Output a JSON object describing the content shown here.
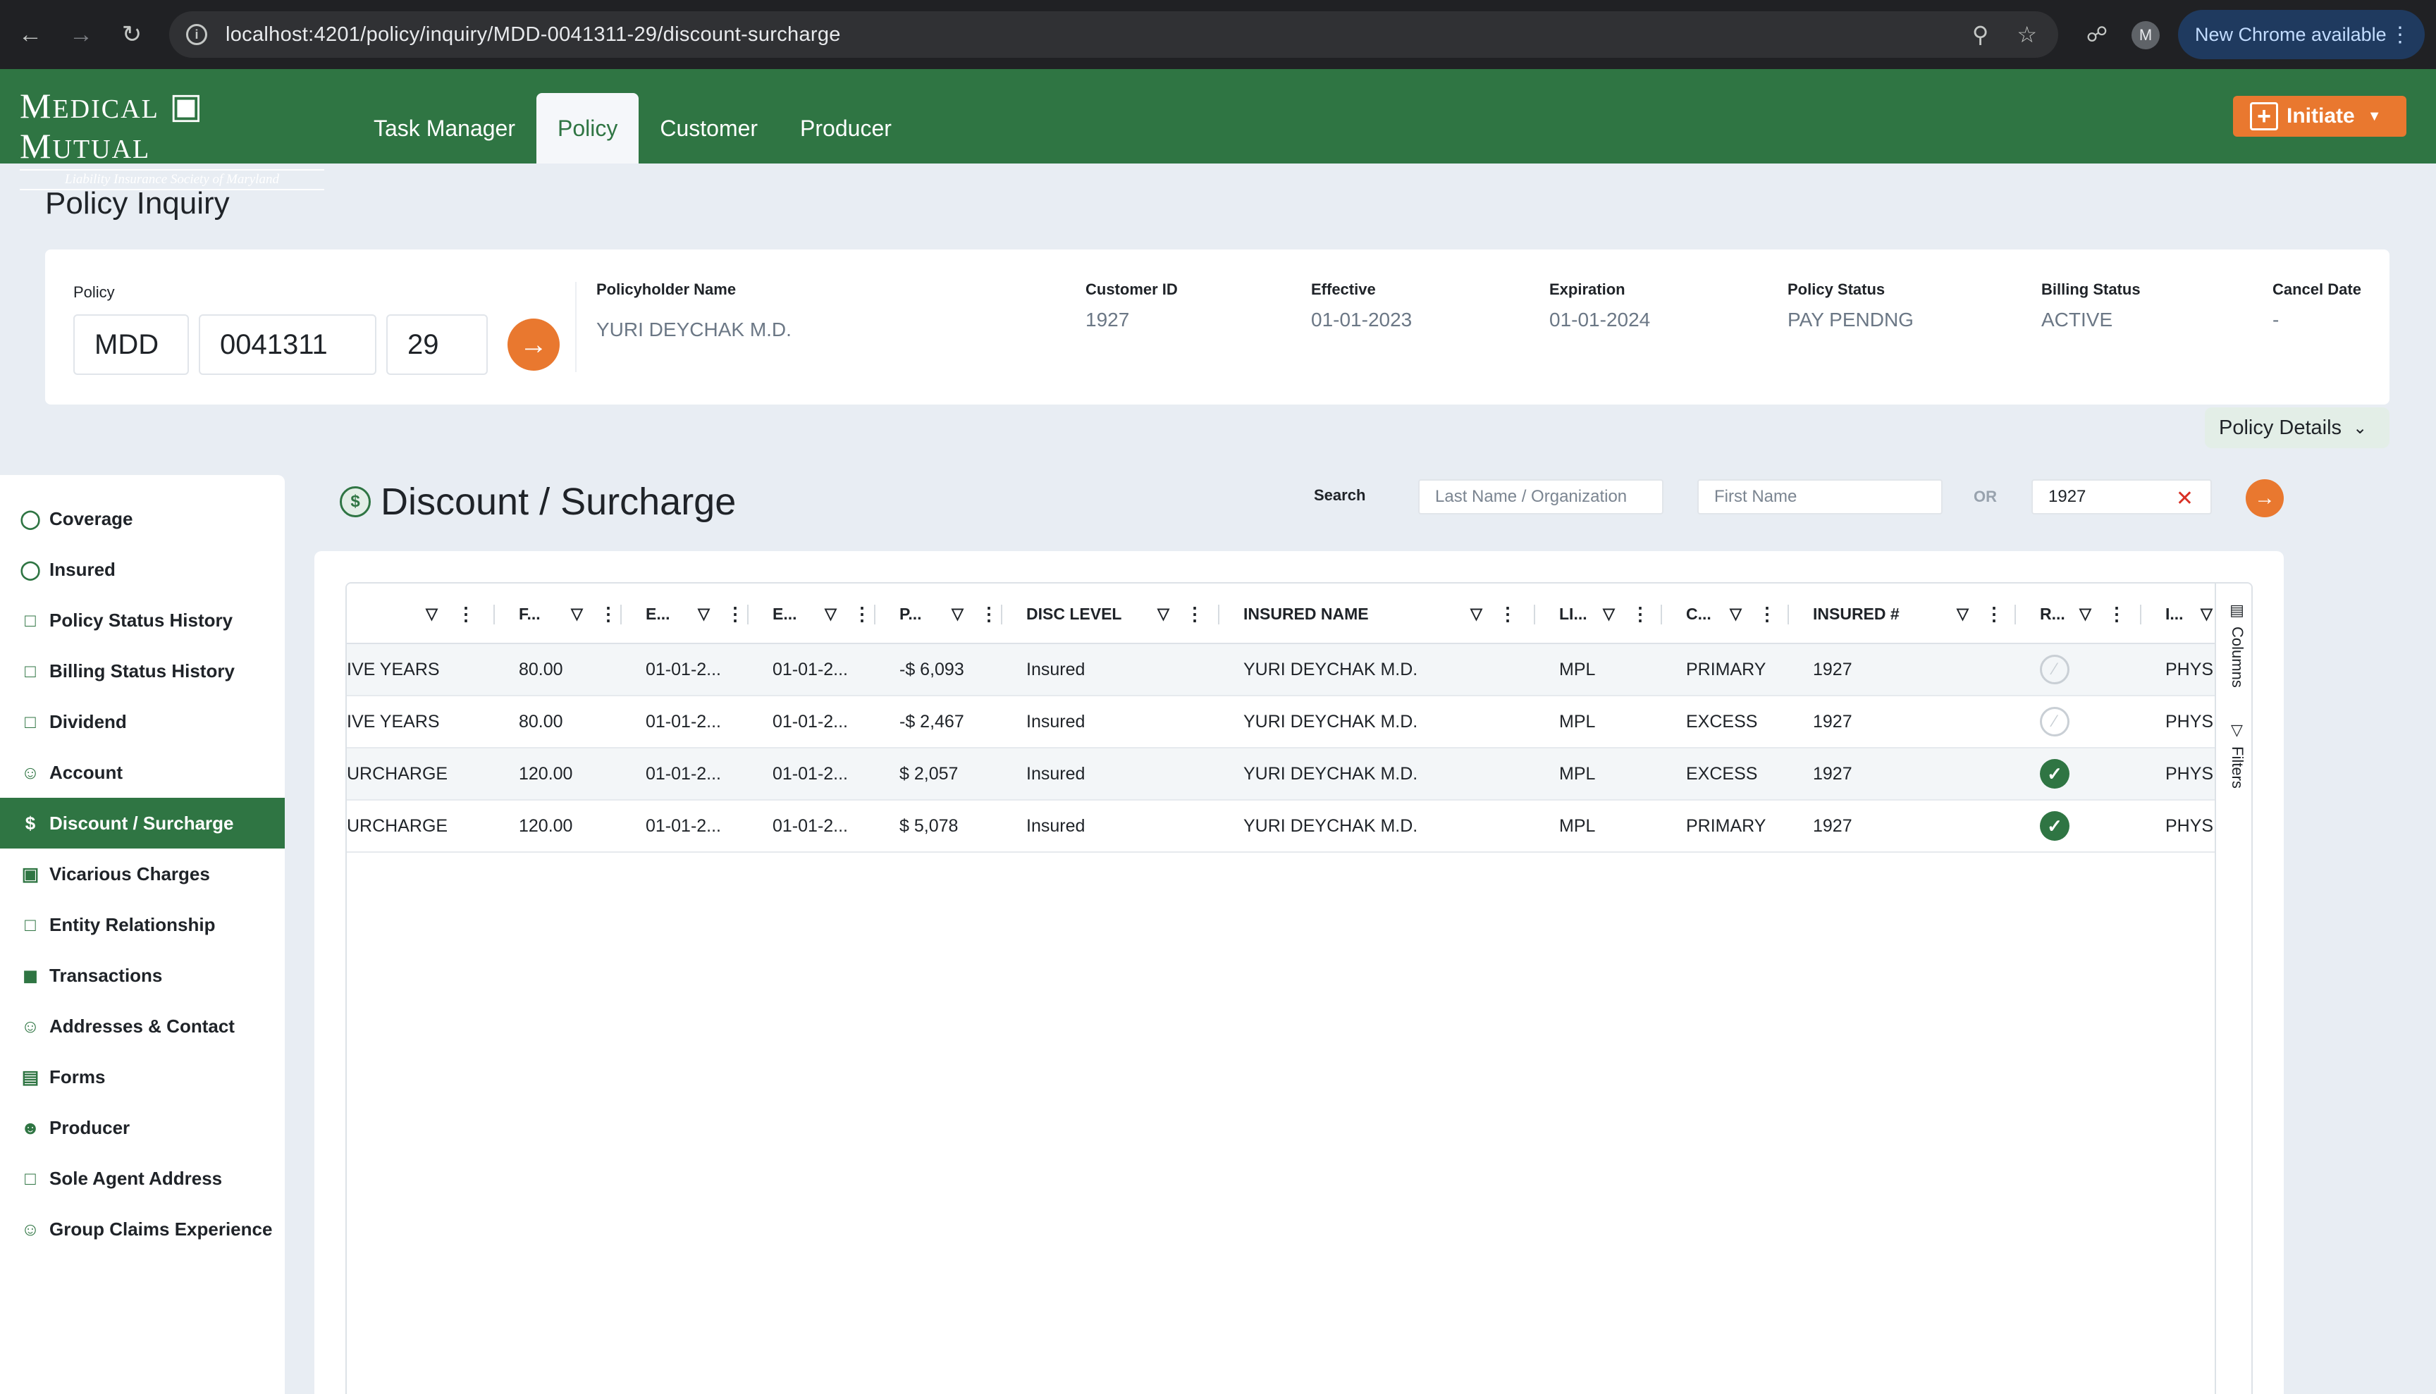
{
  "browser": {
    "url": "localhost:4201/policy/inquiry/MDD-0041311-29/discount-surcharge",
    "avatar": "M",
    "update_label": "New Chrome available"
  },
  "header": {
    "logo_main": "Medical H Mutual",
    "logo_sub": "Liability Insurance Society of Maryland",
    "tabs": [
      "Task Manager",
      "Policy",
      "Customer",
      "Producer"
    ],
    "active_tab": "Policy",
    "initiate_label": "Initiate"
  },
  "page": {
    "title": "Policy Inquiry"
  },
  "policy": {
    "label": "Policy",
    "prefix": "MDD",
    "number": "0041311",
    "suffix": "29",
    "fields": [
      {
        "label": "Policyholder Name",
        "value": "YURI DEYCHAK M.D."
      },
      {
        "label": "Customer ID",
        "value": "1927"
      },
      {
        "label": "Effective",
        "value": "01-01-2023"
      },
      {
        "label": "Expiration",
        "value": "01-01-2024"
      },
      {
        "label": "Policy Status",
        "value": "PAY PENDNG"
      },
      {
        "label": "Billing Status",
        "value": "ACTIVE"
      },
      {
        "label": "Cancel Date",
        "value": "-"
      }
    ],
    "details_label": "Policy Details"
  },
  "sidebar": {
    "items": [
      {
        "label": "Coverage",
        "icon": "shield-icon"
      },
      {
        "label": "Insured",
        "icon": "shield-check-icon"
      },
      {
        "label": "Policy Status History",
        "icon": "clipboard-icon"
      },
      {
        "label": "Billing Status History",
        "icon": "clipboard-icon"
      },
      {
        "label": "Dividend",
        "icon": "clipboard-icon"
      },
      {
        "label": "Account",
        "icon": "person-icon"
      },
      {
        "label": "Discount / Surcharge",
        "icon": "dollar-icon"
      },
      {
        "label": "Vicarious Charges",
        "icon": "image-icon"
      },
      {
        "label": "Entity Relationship",
        "icon": "clipboard-icon"
      },
      {
        "label": "Transactions",
        "icon": "cart-icon"
      },
      {
        "label": "Addresses & Contact",
        "icon": "person-icon"
      },
      {
        "label": "Forms",
        "icon": "document-chart-icon"
      },
      {
        "label": "Producer",
        "icon": "badge-person-icon"
      },
      {
        "label": "Sole Agent Address",
        "icon": "clipboard-icon"
      },
      {
        "label": "Group Claims Experience",
        "icon": "group-icon"
      }
    ],
    "active_index": 6
  },
  "section": {
    "title": "Discount / Surcharge",
    "search_label": "Search",
    "last_name_placeholder": "Last Name / Organization",
    "first_name_placeholder": "First Name",
    "or_label": "OR",
    "id_value": "1927"
  },
  "grid": {
    "columns": [
      "",
      "F...",
      "E...",
      "E...",
      "P...",
      "DISC LEVEL",
      "INSURED NAME",
      "LI...",
      "C...",
      "INSURED #",
      "R...",
      "I..."
    ],
    "rows": [
      {
        "c0": "IVE YEARS",
        "c1": "80.00",
        "c2": "01-01-2...",
        "c3": "01-01-2...",
        "c4": "-$ 6,093",
        "c5": "Insured",
        "c6": "YURI DEYCHAK M.D.",
        "c7": "MPL",
        "c8": "PRIMARY",
        "c9": "1927",
        "c10": false,
        "c11": "PHYSI"
      },
      {
        "c0": "IVE YEARS",
        "c1": "80.00",
        "c2": "01-01-2...",
        "c3": "01-01-2...",
        "c4": "-$ 2,467",
        "c5": "Insured",
        "c6": "YURI DEYCHAK M.D.",
        "c7": "MPL",
        "c8": "EXCESS",
        "c9": "1927",
        "c10": false,
        "c11": "PHYSI"
      },
      {
        "c0": "URCHARGE",
        "c1": "120.00",
        "c2": "01-01-2...",
        "c3": "01-01-2...",
        "c4": "$ 2,057",
        "c5": "Insured",
        "c6": "YURI DEYCHAK M.D.",
        "c7": "MPL",
        "c8": "EXCESS",
        "c9": "1927",
        "c10": true,
        "c11": "PHYSI"
      },
      {
        "c0": "URCHARGE",
        "c1": "120.00",
        "c2": "01-01-2...",
        "c3": "01-01-2...",
        "c4": "$ 5,078",
        "c5": "Insured",
        "c6": "YURI DEYCHAK M.D.",
        "c7": "MPL",
        "c8": "PRIMARY",
        "c9": "1927",
        "c10": true,
        "c11": "PHYSI"
      }
    ],
    "side_tabs": [
      "Columns",
      "Filters"
    ]
  },
  "colors": {
    "brand_green": "#2f7543",
    "accent_orange": "#e9782f",
    "page_bg": "#e8edf3"
  }
}
